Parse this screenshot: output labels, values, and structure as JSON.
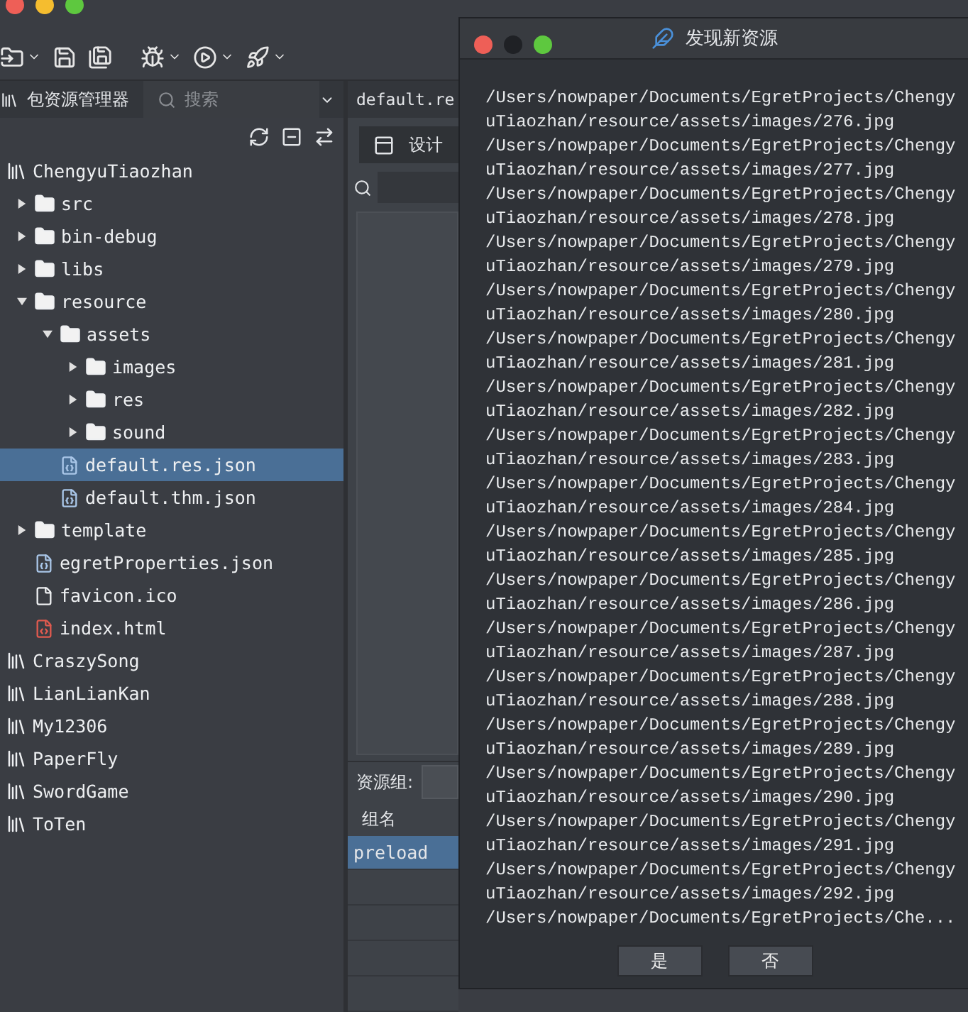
{
  "toolbar": {
    "items": [
      {
        "kind": "import",
        "caret": true
      },
      {
        "kind": "save",
        "caret": false
      },
      {
        "kind": "save-all",
        "caret": false
      },
      {
        "kind": "debug",
        "caret": true
      },
      {
        "kind": "run",
        "caret": true
      },
      {
        "kind": "publish",
        "caret": true
      }
    ]
  },
  "explorer": {
    "tab": "包资源管理器",
    "search": {
      "placeholder": "搜索"
    },
    "tree": [
      {
        "name": "ChengyuTiaozhan",
        "kind": "project",
        "selected": false,
        "children": [
          {
            "name": "src",
            "kind": "folder",
            "expanded": false,
            "selected": false
          },
          {
            "name": "bin-debug",
            "kind": "folder",
            "expanded": false,
            "selected": false
          },
          {
            "name": "libs",
            "kind": "folder",
            "expanded": false,
            "selected": false
          },
          {
            "name": "resource",
            "kind": "folder",
            "expanded": true,
            "selected": false,
            "children": [
              {
                "name": "assets",
                "kind": "folder",
                "expanded": true,
                "selected": false,
                "children": [
                  {
                    "name": "images",
                    "kind": "folder",
                    "expanded": false,
                    "selected": false
                  },
                  {
                    "name": "res",
                    "kind": "folder",
                    "expanded": false,
                    "selected": false
                  },
                  {
                    "name": "sound",
                    "kind": "folder",
                    "expanded": false,
                    "selected": false
                  }
                ]
              },
              {
                "name": "default.res.json",
                "kind": "json",
                "selected": true
              },
              {
                "name": "default.thm.json",
                "kind": "json",
                "selected": false
              }
            ]
          },
          {
            "name": "template",
            "kind": "folder",
            "expanded": false,
            "selected": false
          },
          {
            "name": "egretProperties.json",
            "kind": "json",
            "selected": false
          },
          {
            "name": "favicon.ico",
            "kind": "file",
            "selected": false
          },
          {
            "name": "index.html",
            "kind": "html",
            "selected": false
          }
        ]
      },
      {
        "name": "CraszySong",
        "kind": "project",
        "selected": false
      },
      {
        "name": "LianLianKan",
        "kind": "project",
        "selected": false
      },
      {
        "name": "My12306",
        "kind": "project",
        "selected": false
      },
      {
        "name": "PaperFly",
        "kind": "project",
        "selected": false
      },
      {
        "name": "SwordGame",
        "kind": "project",
        "selected": false
      },
      {
        "name": "ToTen",
        "kind": "project",
        "selected": false
      }
    ]
  },
  "editor": {
    "tab": "default.re",
    "design_button": "设计",
    "group_label": "资源组:",
    "table": {
      "columns": [
        "组名"
      ],
      "rows": [
        {
          "name": "preload",
          "selected": true
        }
      ]
    }
  },
  "dialog": {
    "title": "发现新资源",
    "lines": [
      "/Users/nowpaper/Documents/EgretProjects/Chengy",
      "uTiaozhan/resource/assets/images/276.jpg",
      "/Users/nowpaper/Documents/EgretProjects/Chengy",
      "uTiaozhan/resource/assets/images/277.jpg",
      "/Users/nowpaper/Documents/EgretProjects/Chengy",
      "uTiaozhan/resource/assets/images/278.jpg",
      "/Users/nowpaper/Documents/EgretProjects/Chengy",
      "uTiaozhan/resource/assets/images/279.jpg",
      "/Users/nowpaper/Documents/EgretProjects/Chengy",
      "uTiaozhan/resource/assets/images/280.jpg",
      "/Users/nowpaper/Documents/EgretProjects/Chengy",
      "uTiaozhan/resource/assets/images/281.jpg",
      "/Users/nowpaper/Documents/EgretProjects/Chengy",
      "uTiaozhan/resource/assets/images/282.jpg",
      "/Users/nowpaper/Documents/EgretProjects/Chengy",
      "uTiaozhan/resource/assets/images/283.jpg",
      "/Users/nowpaper/Documents/EgretProjects/Chengy",
      "uTiaozhan/resource/assets/images/284.jpg",
      "/Users/nowpaper/Documents/EgretProjects/Chengy",
      "uTiaozhan/resource/assets/images/285.jpg",
      "/Users/nowpaper/Documents/EgretProjects/Chengy",
      "uTiaozhan/resource/assets/images/286.jpg",
      "/Users/nowpaper/Documents/EgretProjects/Chengy",
      "uTiaozhan/resource/assets/images/287.jpg",
      "/Users/nowpaper/Documents/EgretProjects/Chengy",
      "uTiaozhan/resource/assets/images/288.jpg",
      "/Users/nowpaper/Documents/EgretProjects/Chengy",
      "uTiaozhan/resource/assets/images/289.jpg",
      "/Users/nowpaper/Documents/EgretProjects/Chengy",
      "uTiaozhan/resource/assets/images/290.jpg",
      "/Users/nowpaper/Documents/EgretProjects/Chengy",
      "uTiaozhan/resource/assets/images/291.jpg",
      "/Users/nowpaper/Documents/EgretProjects/Chengy",
      "uTiaozhan/resource/assets/images/292.jpg",
      "/Users/nowpaper/Documents/EgretProjects/Che..."
    ],
    "buttons": [
      "是",
      "否"
    ]
  }
}
